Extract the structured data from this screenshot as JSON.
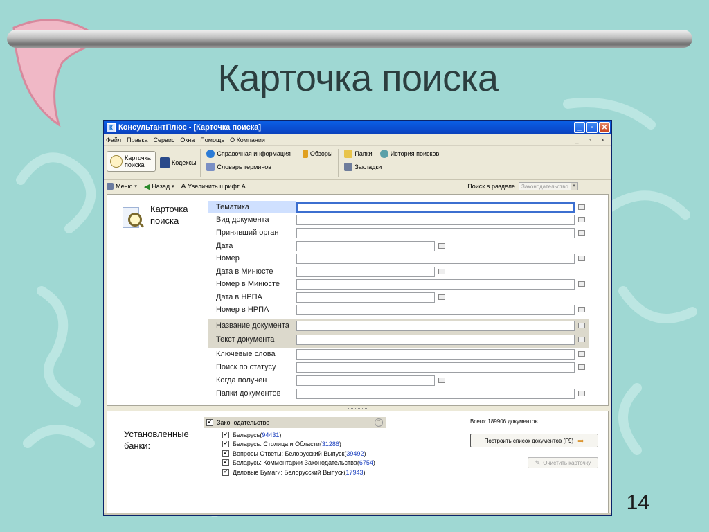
{
  "slide": {
    "title": "Карточка поиска",
    "page_number": "14"
  },
  "window": {
    "title": "КонсультантПлюс - [Карточка поиска]",
    "buttons": [
      "minimize",
      "maximize",
      "close"
    ]
  },
  "menu": {
    "items": [
      "Файл",
      "Правка",
      "Сервис",
      "Окна",
      "Помощь",
      "О Компании"
    ],
    "mdi_controls": "_ ▫ ×"
  },
  "toolbar": {
    "search_card": "Карточка поиска",
    "codes": "Кодексы",
    "reference_info": "Справочная информация",
    "reviews": "Обзоры",
    "term_dictionary": "Словарь терминов",
    "folders": "Папки",
    "search_history": "История поисков",
    "bookmarks": "Закладки"
  },
  "navbar": {
    "menu": "Меню",
    "back": "Назад",
    "zoom_font": "Увеличить шрифт",
    "search_in_section_label": "Поиск в разделе",
    "search_in_section_value": "Законодательство"
  },
  "card": {
    "heading_line1": "Карточка",
    "heading_line2": "поиска",
    "fields": [
      "Тематика",
      "Вид документа",
      "Принявший орган",
      "Дата",
      "Номер",
      "Дата в Минюсте",
      "Номер в Минюсте",
      "Дата в НРПА",
      "Номер в НРПА",
      "Название документа",
      "Текст документа",
      "Ключевые слова",
      "Поиск по статусу",
      "Когда получен",
      "Папки документов"
    ]
  },
  "banks": {
    "label_line1": "Установленные",
    "label_line2": "банки:",
    "group": "Законодательство",
    "items": [
      {
        "name": "Беларусь",
        "count": "94431"
      },
      {
        "name": "Беларусь: Столица и Области",
        "count": "31286"
      },
      {
        "name": "Вопросы Ответы: Белорусский Выпуск",
        "count": "39492"
      },
      {
        "name": "Беларусь: Комментарии Законодательства",
        "count": "6754"
      },
      {
        "name": "Деловые Бумаги: Белорусский Выпуск",
        "count": "17943"
      }
    ],
    "total": "Всего: 189906 документов",
    "build_button": "Построить список документов (F9)",
    "clear_button": "Очистить карточку"
  },
  "colors": {
    "background": "#9fd8d3",
    "title_bar": "#0a4dd0",
    "highlight": "#dcd9cc",
    "active_field": "#cfe0ff",
    "count_link": "#1a3fbf"
  }
}
